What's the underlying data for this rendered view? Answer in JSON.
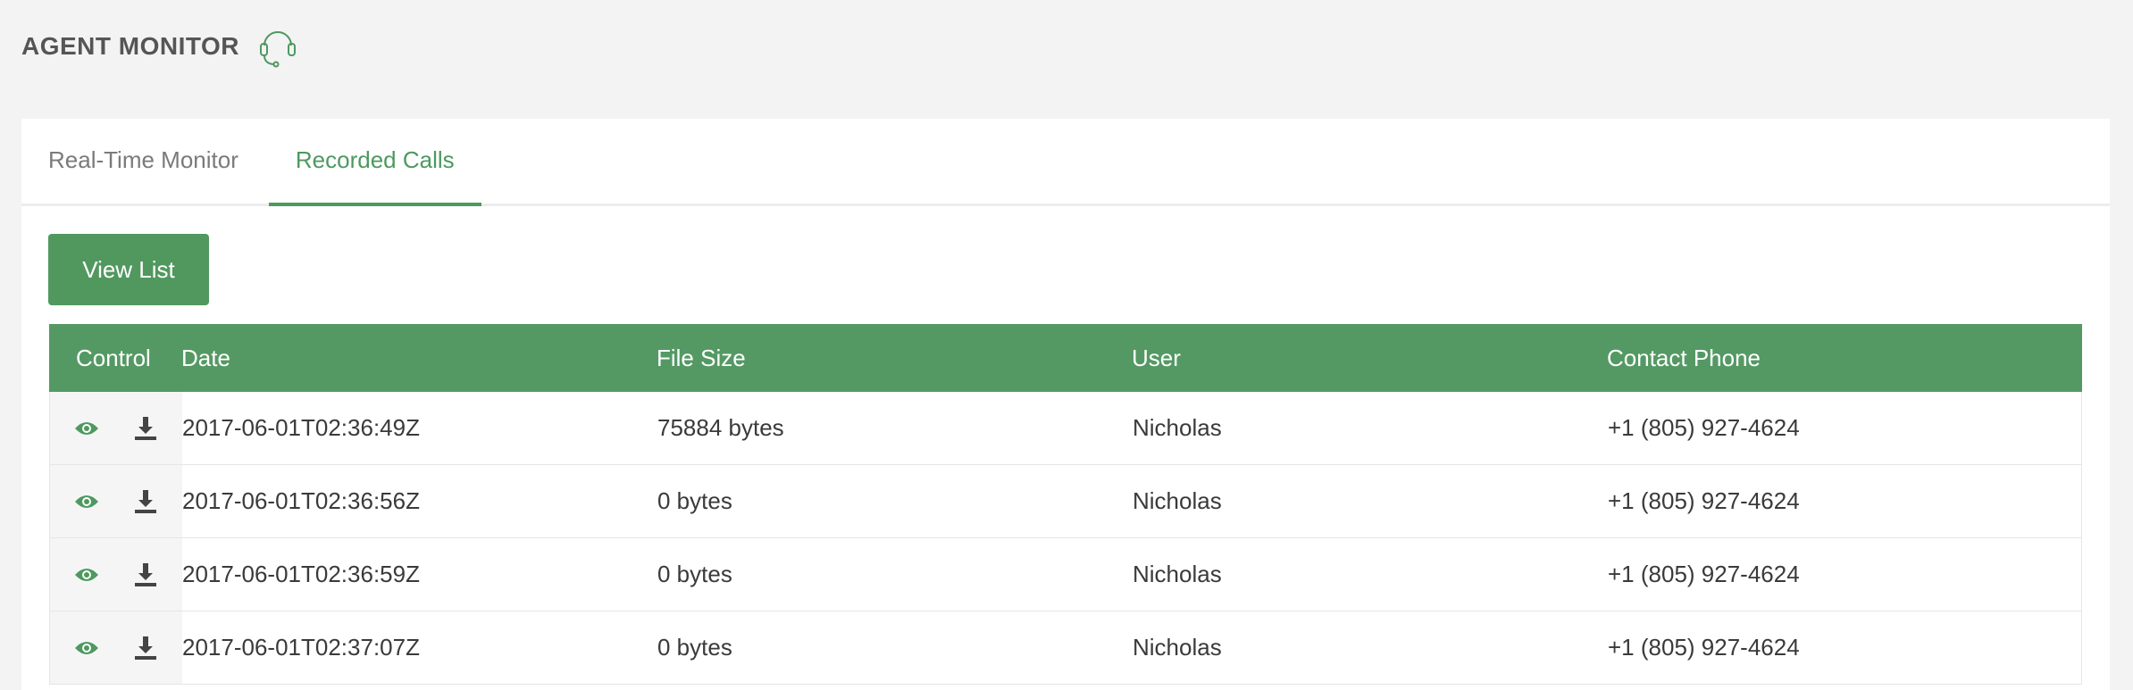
{
  "app": {
    "title": "AGENT MONITOR",
    "icon": "headset-icon",
    "accent_color": "#51985f"
  },
  "tabs": [
    {
      "label": "Real-Time Monitor",
      "active": false
    },
    {
      "label": "Recorded Calls",
      "active": true
    }
  ],
  "toolbar": {
    "view_list_label": "View List"
  },
  "table": {
    "columns": [
      "Control",
      "Date",
      "File Size",
      "User",
      "Contact Phone"
    ],
    "row_icons": [
      "eye-icon",
      "download-icon"
    ],
    "rows": [
      {
        "date": "2017-06-01T02:36:49Z",
        "size": "75884 bytes",
        "user": "Nicholas",
        "phone": "+1 (805) 927-4624"
      },
      {
        "date": "2017-06-01T02:36:56Z",
        "size": "0 bytes",
        "user": "Nicholas",
        "phone": "+1 (805) 927-4624"
      },
      {
        "date": "2017-06-01T02:36:59Z",
        "size": "0 bytes",
        "user": "Nicholas",
        "phone": "+1 (805) 927-4624"
      },
      {
        "date": "2017-06-01T02:37:07Z",
        "size": "0 bytes",
        "user": "Nicholas",
        "phone": "+1 (805) 927-4624"
      }
    ]
  }
}
